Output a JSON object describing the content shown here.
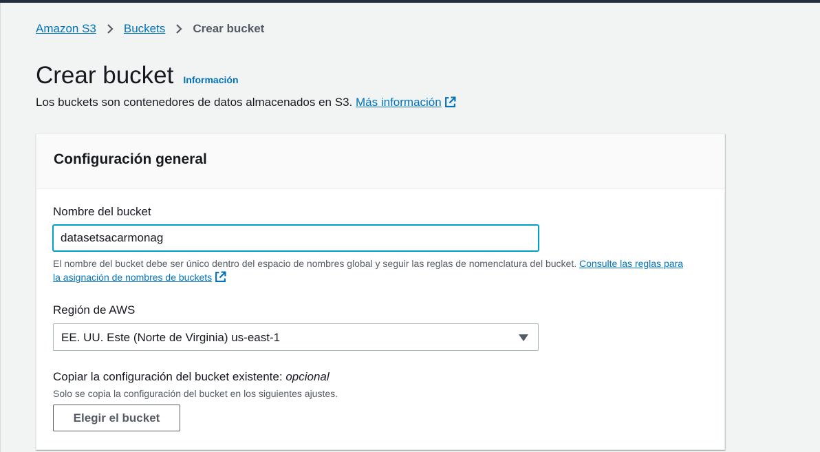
{
  "breadcrumb": {
    "items": [
      "Amazon S3",
      "Buckets"
    ],
    "current": "Crear bucket"
  },
  "header": {
    "title": "Crear bucket",
    "info_link": "Información",
    "description": "Los buckets son contenedores de datos almacenados en S3.",
    "more_info_link": "Más información"
  },
  "panel": {
    "title": "Configuración general",
    "bucket_name": {
      "label": "Nombre del bucket",
      "value": "datasetsacarmonag",
      "hint": "El nombre del bucket debe ser único dentro del espacio de nombres global y seguir las reglas de nomenclatura del bucket.",
      "hint_link": "Consulte las reglas para la asignación de nombres de buckets"
    },
    "region": {
      "label": "Región de AWS",
      "selected": "EE. UU. Este (Norte de Virginia) us-east-1"
    },
    "copy_config": {
      "label": "Copiar la configuración del bucket existente:",
      "optional": "opcional",
      "description": "Solo se copia la configuración del bucket en los siguientes ajustes.",
      "button_label": "Elegir el bucket"
    }
  },
  "colors": {
    "link": "#0073bb",
    "focus_border": "#00a1c9",
    "top_bar": "#232f3e",
    "page_bg": "#f2f3f3"
  },
  "icons": [
    "chevron-right-icon",
    "external-link-icon",
    "caret-down-icon"
  ]
}
